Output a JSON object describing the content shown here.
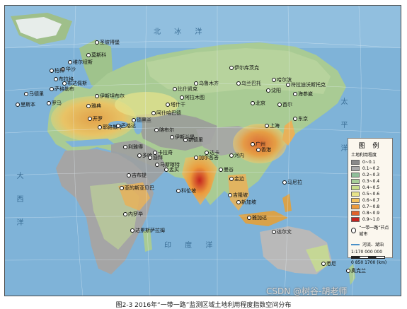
{
  "figure": {
    "caption": "图2-3  2016年“一带一路”监测区域土地利用程度指数空间分布",
    "watermark": "CSDN @树谷-胡老师"
  },
  "oceans": {
    "arctic": "北  冰  洋",
    "atlantic": "大  西  洋",
    "indian": "印  度  洋",
    "pacific": "太  平  洋"
  },
  "legend": {
    "title": "图 例",
    "subtitle": "土地利用程度",
    "classes": [
      {
        "label": "0~0.1",
        "color": "#8a8a8a"
      },
      {
        "label": "0.1~0.2",
        "color": "#a9a9a9"
      },
      {
        "label": "0.2~0.3",
        "color": "#8fbf9a"
      },
      {
        "label": "0.3~0.4",
        "color": "#a7cf9a"
      },
      {
        "label": "0.4~0.5",
        "color": "#c8de8c"
      },
      {
        "label": "0.5~0.6",
        "color": "#e8e38a"
      },
      {
        "label": "0.6~0.7",
        "color": "#f3c25e"
      },
      {
        "label": "0.7~0.8",
        "color": "#ec9a3c"
      },
      {
        "label": "0.8~0.9",
        "color": "#e0622a"
      },
      {
        "label": "0.9~1.0",
        "color": "#c4241f"
      }
    ],
    "node_symbol_label": "“一带一路”节点城市",
    "water_label": "河流、湖泊",
    "scale_label": "1:170 000 000",
    "scale_ticks": "0  850  1700 (km)"
  },
  "cities": [
    "圣彼得堡",
    "莫斯科",
    "维尔纽斯",
    "华沙",
    "柏林",
    "布拉格",
    "布达佩斯",
    "萨格勒布",
    "伊斯坦布尔",
    "雅典",
    "马德里",
    "里斯本",
    "罗马",
    "开罗",
    "耶路撒冷",
    "巴格达",
    "德黑兰",
    "阿什哈巴德",
    "塔什干",
    "阿拉木图",
    "比什凯克",
    "乌鲁木齐",
    "伊尔库茨克",
    "乌兰巴托",
    "北京",
    "哈尔滨",
    "沈阳",
    "首尔",
    "东京",
    "上海",
    "广州",
    "香港",
    "河内",
    "曼谷",
    "金边",
    "吉隆坡",
    "新加坡",
    "雅加达",
    "马尼拉",
    "达卡",
    "加尔各答",
    "新德里",
    "孟买",
    "科伦坡",
    "卡拉奇",
    "伊斯兰堡",
    "喀布尔",
    "利雅得",
    "多哈",
    "迪拜",
    "马斯喀特",
    "吉布提",
    "亚的斯亚贝巴",
    "内罗毕",
    "达累斯萨拉姆",
    "达尔文",
    "悉尼",
    "奥克兰",
    "符拉迪沃斯托克",
    "海参崴"
  ]
}
